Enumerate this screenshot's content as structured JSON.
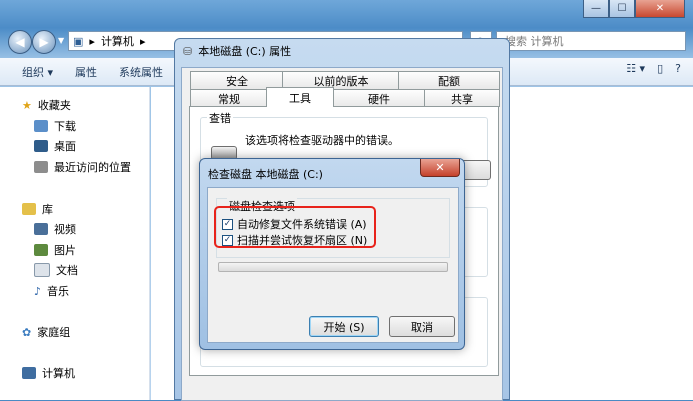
{
  "explorer": {
    "breadcrumb": "计算机",
    "search_placeholder": "搜索 计算机",
    "window_controls": {
      "minimize": "—",
      "maximize": "☐",
      "close": "✕"
    },
    "toolbar": [
      "组织 ▾",
      "属性",
      "系统属性"
    ],
    "view_controls": [
      "☷ ▾",
      "▯",
      "?"
    ]
  },
  "nav_pane": {
    "favorites": "收藏夹",
    "favorites_items": [
      "下载",
      "桌面",
      "最近访问的位置"
    ],
    "libraries": "库",
    "libraries_items": [
      "视频",
      "图片",
      "文档",
      "音乐"
    ],
    "homegroup": "家庭组",
    "computer": "计算机"
  },
  "properties_dialog": {
    "title": "本地磁盘 (C:) 属性",
    "tabs_row1": [
      "安全",
      "以前的版本",
      "配额"
    ],
    "tabs_row2": [
      "常规",
      "工具",
      "硬件",
      "共享"
    ],
    "active_tab": "工具",
    "error_check_group": "查错",
    "error_check_desc": "该选项将检查驱动器中的错误。"
  },
  "check_disk_dialog": {
    "title": "检查磁盘 本地磁盘 (C:)",
    "options_group": "磁盘检查选项",
    "option1": "自动修复文件系统错误 (A)",
    "option1_checked": true,
    "option2": "扫描并尝试恢复坏扇区 (N)",
    "option2_checked": true,
    "checkmark": "✓",
    "start_button": "开始 (S)",
    "cancel_button": "取消"
  },
  "colors": {
    "highlight": "#e8231b",
    "title_bar": "#4c8cc7"
  }
}
